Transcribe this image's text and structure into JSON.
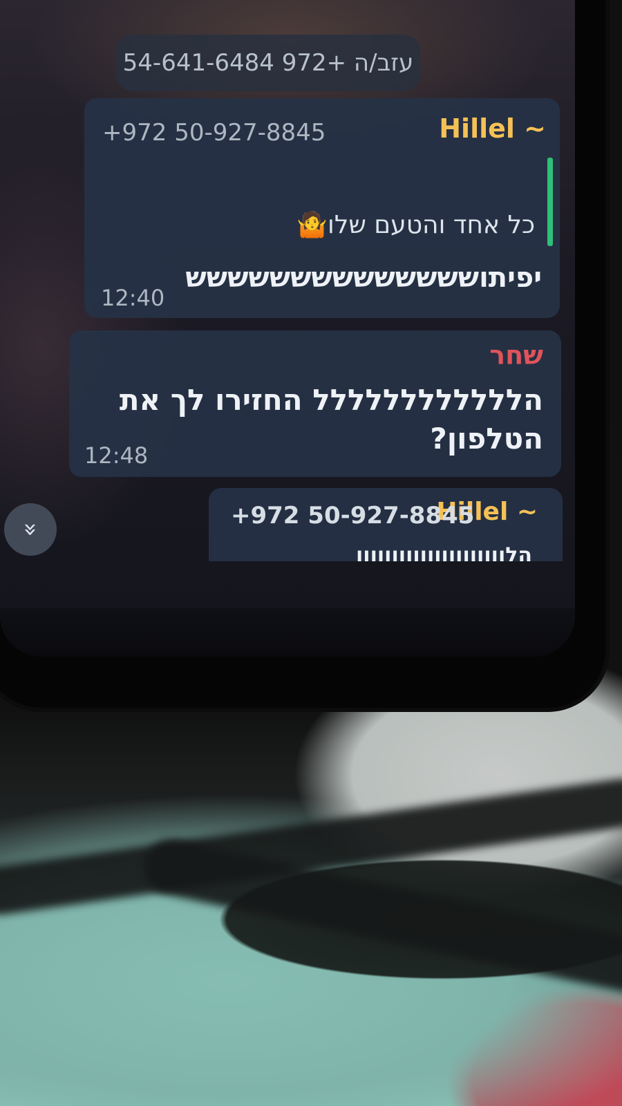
{
  "system_message": {
    "text": "עזב/ה +972 54-641-6484"
  },
  "messages": [
    {
      "sender": "~ Hillel",
      "phone": "+972 50-927-8845",
      "reply_quote": "כל אחד והטעם שלו🤷",
      "text": "יפיתושששששששששששששש",
      "time": "12:40"
    },
    {
      "sender": "שחר",
      "text_line1": "הלללללללללללל החזירו לך את",
      "text_line2": "הטלפון?",
      "time": "12:48"
    },
    {
      "sender": "~ Hillel",
      "phone": "+972 50-927-8845",
      "text_partial": "הלווווווווווווווווווווו"
    }
  ],
  "scroll_button": {
    "icon": "double-chevron-down-icon",
    "glyph": "»"
  },
  "colors": {
    "bubble": "#263246",
    "sender_yellow": "#f5c156",
    "sender_red": "#e0535b",
    "reply_bar": "#2fbf78"
  }
}
